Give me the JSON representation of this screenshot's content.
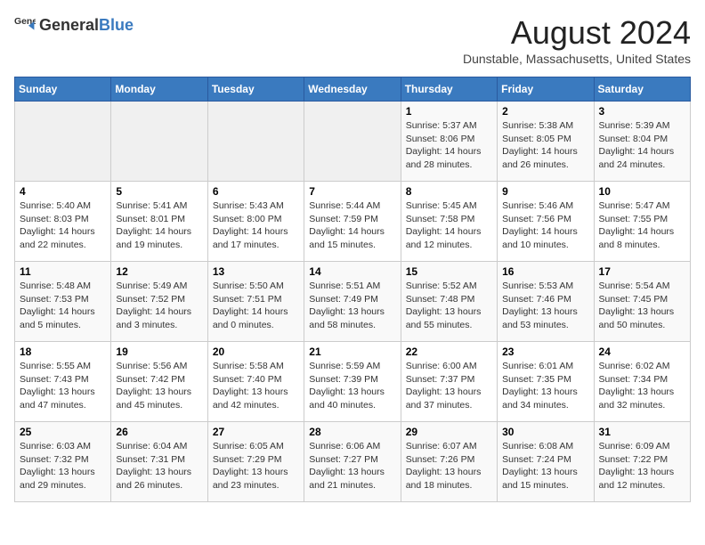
{
  "header": {
    "logo_general": "General",
    "logo_blue": "Blue",
    "month_year": "August 2024",
    "location": "Dunstable, Massachusetts, United States"
  },
  "calendar": {
    "days_of_week": [
      "Sunday",
      "Monday",
      "Tuesday",
      "Wednesday",
      "Thursday",
      "Friday",
      "Saturday"
    ],
    "weeks": [
      [
        {
          "day": "",
          "info": ""
        },
        {
          "day": "",
          "info": ""
        },
        {
          "day": "",
          "info": ""
        },
        {
          "day": "",
          "info": ""
        },
        {
          "day": "1",
          "info": "Sunrise: 5:37 AM\nSunset: 8:06 PM\nDaylight: 14 hours\nand 28 minutes."
        },
        {
          "day": "2",
          "info": "Sunrise: 5:38 AM\nSunset: 8:05 PM\nDaylight: 14 hours\nand 26 minutes."
        },
        {
          "day": "3",
          "info": "Sunrise: 5:39 AM\nSunset: 8:04 PM\nDaylight: 14 hours\nand 24 minutes."
        }
      ],
      [
        {
          "day": "4",
          "info": "Sunrise: 5:40 AM\nSunset: 8:03 PM\nDaylight: 14 hours\nand 22 minutes."
        },
        {
          "day": "5",
          "info": "Sunrise: 5:41 AM\nSunset: 8:01 PM\nDaylight: 14 hours\nand 19 minutes."
        },
        {
          "day": "6",
          "info": "Sunrise: 5:43 AM\nSunset: 8:00 PM\nDaylight: 14 hours\nand 17 minutes."
        },
        {
          "day": "7",
          "info": "Sunrise: 5:44 AM\nSunset: 7:59 PM\nDaylight: 14 hours\nand 15 minutes."
        },
        {
          "day": "8",
          "info": "Sunrise: 5:45 AM\nSunset: 7:58 PM\nDaylight: 14 hours\nand 12 minutes."
        },
        {
          "day": "9",
          "info": "Sunrise: 5:46 AM\nSunset: 7:56 PM\nDaylight: 14 hours\nand 10 minutes."
        },
        {
          "day": "10",
          "info": "Sunrise: 5:47 AM\nSunset: 7:55 PM\nDaylight: 14 hours\nand 8 minutes."
        }
      ],
      [
        {
          "day": "11",
          "info": "Sunrise: 5:48 AM\nSunset: 7:53 PM\nDaylight: 14 hours\nand 5 minutes."
        },
        {
          "day": "12",
          "info": "Sunrise: 5:49 AM\nSunset: 7:52 PM\nDaylight: 14 hours\nand 3 minutes."
        },
        {
          "day": "13",
          "info": "Sunrise: 5:50 AM\nSunset: 7:51 PM\nDaylight: 14 hours\nand 0 minutes."
        },
        {
          "day": "14",
          "info": "Sunrise: 5:51 AM\nSunset: 7:49 PM\nDaylight: 13 hours\nand 58 minutes."
        },
        {
          "day": "15",
          "info": "Sunrise: 5:52 AM\nSunset: 7:48 PM\nDaylight: 13 hours\nand 55 minutes."
        },
        {
          "day": "16",
          "info": "Sunrise: 5:53 AM\nSunset: 7:46 PM\nDaylight: 13 hours\nand 53 minutes."
        },
        {
          "day": "17",
          "info": "Sunrise: 5:54 AM\nSunset: 7:45 PM\nDaylight: 13 hours\nand 50 minutes."
        }
      ],
      [
        {
          "day": "18",
          "info": "Sunrise: 5:55 AM\nSunset: 7:43 PM\nDaylight: 13 hours\nand 47 minutes."
        },
        {
          "day": "19",
          "info": "Sunrise: 5:56 AM\nSunset: 7:42 PM\nDaylight: 13 hours\nand 45 minutes."
        },
        {
          "day": "20",
          "info": "Sunrise: 5:58 AM\nSunset: 7:40 PM\nDaylight: 13 hours\nand 42 minutes."
        },
        {
          "day": "21",
          "info": "Sunrise: 5:59 AM\nSunset: 7:39 PM\nDaylight: 13 hours\nand 40 minutes."
        },
        {
          "day": "22",
          "info": "Sunrise: 6:00 AM\nSunset: 7:37 PM\nDaylight: 13 hours\nand 37 minutes."
        },
        {
          "day": "23",
          "info": "Sunrise: 6:01 AM\nSunset: 7:35 PM\nDaylight: 13 hours\nand 34 minutes."
        },
        {
          "day": "24",
          "info": "Sunrise: 6:02 AM\nSunset: 7:34 PM\nDaylight: 13 hours\nand 32 minutes."
        }
      ],
      [
        {
          "day": "25",
          "info": "Sunrise: 6:03 AM\nSunset: 7:32 PM\nDaylight: 13 hours\nand 29 minutes."
        },
        {
          "day": "26",
          "info": "Sunrise: 6:04 AM\nSunset: 7:31 PM\nDaylight: 13 hours\nand 26 minutes."
        },
        {
          "day": "27",
          "info": "Sunrise: 6:05 AM\nSunset: 7:29 PM\nDaylight: 13 hours\nand 23 minutes."
        },
        {
          "day": "28",
          "info": "Sunrise: 6:06 AM\nSunset: 7:27 PM\nDaylight: 13 hours\nand 21 minutes."
        },
        {
          "day": "29",
          "info": "Sunrise: 6:07 AM\nSunset: 7:26 PM\nDaylight: 13 hours\nand 18 minutes."
        },
        {
          "day": "30",
          "info": "Sunrise: 6:08 AM\nSunset: 7:24 PM\nDaylight: 13 hours\nand 15 minutes."
        },
        {
          "day": "31",
          "info": "Sunrise: 6:09 AM\nSunset: 7:22 PM\nDaylight: 13 hours\nand 12 minutes."
        }
      ]
    ]
  }
}
